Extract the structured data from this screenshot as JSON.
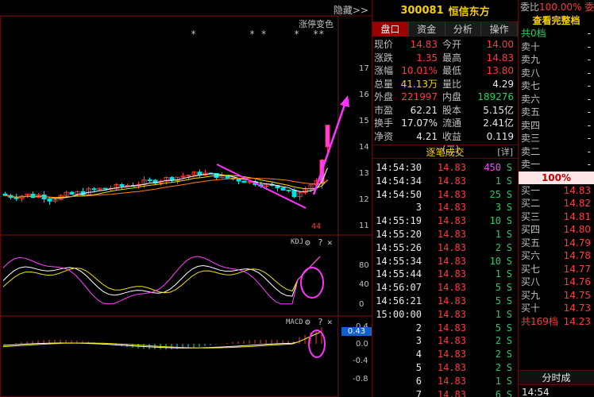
{
  "chart": {
    "hide_label": "隐藏>>",
    "limit_label": "涨停变色",
    "stars": [
      "*",
      "* *",
      "*",
      "**"
    ],
    "price_axis": [
      "17",
      "16",
      "15",
      "14",
      "13",
      "12",
      "11"
    ],
    "kdj": {
      "label": "KDJ",
      "axis": [
        "80",
        "40",
        "0"
      ]
    },
    "macd": {
      "label": "MACD",
      "axis": [
        "0.4",
        "0.0",
        "-0.4",
        "-0.8"
      ],
      "current": "0.43"
    },
    "low_marker": "44",
    "colors": {
      "up": "#ff3333",
      "down": "#00e0e0",
      "ma1": "#ffffff",
      "ma2": "#f0e000",
      "ma3": "#ff40ff",
      "annotation": "#ff33ff"
    }
  },
  "stock": {
    "code": "300081",
    "name": "恒信东方"
  },
  "tabs": [
    "盘口",
    "资金",
    "分析",
    "操作"
  ],
  "quote": [
    {
      "l": "现价",
      "v": "14.83",
      "vc": "red",
      "l2": "今开",
      "v2": "14.00",
      "v2c": "red"
    },
    {
      "l": "涨跌",
      "v": "1.35",
      "vc": "red",
      "l2": "最高",
      "v2": "14.83",
      "v2c": "red"
    },
    {
      "l": "涨幅",
      "v": "10.01%",
      "vc": "red",
      "l2": "最低",
      "v2": "13.80",
      "v2c": "red"
    },
    {
      "l": "总量",
      "v": "41.13万",
      "vc": "yellow",
      "l2": "量比",
      "v2": "4.29",
      "v2c": "white"
    },
    {
      "l": "外盘",
      "v": "221997",
      "vc": "red",
      "l2": "内盘",
      "v2": "189276",
      "v2c": "green"
    },
    {
      "l": "市盈",
      "v": "62.21",
      "vc": "white",
      "l2": "股本",
      "v2": "5.15亿",
      "v2c": "white"
    },
    {
      "l": "换手",
      "v": "17.07%",
      "vc": "white",
      "l2": "流通",
      "v2": "2.41亿",
      "v2c": "white"
    },
    {
      "l": "净资",
      "v": "4.21",
      "vc": "white",
      "l2": "收益(二)",
      "v2": "0.119",
      "v2c": "white"
    }
  ],
  "trades_header": {
    "title": "逐笔成交",
    "detail": "[详]"
  },
  "trades": [
    {
      "t": "14:54:30",
      "p": "14.83",
      "v": "450",
      "vc": "magenta",
      "s": "S"
    },
    {
      "t": "14:54:34",
      "p": "14.83",
      "v": "1",
      "vc": "green",
      "s": "S"
    },
    {
      "t": "14:54:50",
      "p": "14.83",
      "v": "25",
      "vc": "green",
      "s": "S"
    },
    {
      "t": "3",
      "p": "14.83",
      "v": "3",
      "vc": "green",
      "s": "S"
    },
    {
      "t": "14:55:19",
      "p": "14.83",
      "v": "10",
      "vc": "green",
      "s": "S"
    },
    {
      "t": "14:55:20",
      "p": "14.83",
      "v": "1",
      "vc": "green",
      "s": "S"
    },
    {
      "t": "14:55:26",
      "p": "14.83",
      "v": "2",
      "vc": "green",
      "s": "S"
    },
    {
      "t": "14:55:34",
      "p": "14.83",
      "v": "10",
      "vc": "green",
      "s": "S"
    },
    {
      "t": "14:55:44",
      "p": "14.83",
      "v": "1",
      "vc": "green",
      "s": "S"
    },
    {
      "t": "14:56:07",
      "p": "14.83",
      "v": "5",
      "vc": "green",
      "s": "S"
    },
    {
      "t": "14:56:21",
      "p": "14.83",
      "v": "5",
      "vc": "green",
      "s": "S"
    },
    {
      "t": "15:00:00",
      "p": "14.83",
      "v": "1",
      "vc": "green",
      "s": "S"
    },
    {
      "t": "2",
      "p": "14.83",
      "v": "5",
      "vc": "green",
      "s": "S"
    },
    {
      "t": "3",
      "p": "14.83",
      "v": "2",
      "vc": "green",
      "s": "S"
    },
    {
      "t": "4",
      "p": "14.83",
      "v": "2",
      "vc": "green",
      "s": "S"
    },
    {
      "t": "5",
      "p": "14.83",
      "v": "2",
      "vc": "green",
      "s": "S"
    },
    {
      "t": "6",
      "p": "14.83",
      "v": "1",
      "vc": "green",
      "s": "S"
    },
    {
      "t": "7",
      "p": "14.83",
      "v": "6",
      "vc": "green",
      "s": "S"
    }
  ],
  "orderbook": {
    "ratio_label": "委比",
    "ratio_value": "100.00% 委",
    "full_button": "查看完整档",
    "sell_total": "共0档",
    "sells": [
      "卖十",
      "卖九",
      "卖八",
      "卖七",
      "卖六",
      "卖五",
      "卖四",
      "卖三",
      "卖二",
      "卖一"
    ],
    "sell_values": [
      "-",
      "-",
      "-",
      "-",
      "-",
      "-",
      "-",
      "-",
      "-",
      "-"
    ],
    "buy_pct": "100%",
    "buys": [
      {
        "n": "买一",
        "p": "14.83"
      },
      {
        "n": "买二",
        "p": "14.82"
      },
      {
        "n": "买三",
        "p": "14.81"
      },
      {
        "n": "买四",
        "p": "14.80"
      },
      {
        "n": "买五",
        "p": "14.79"
      },
      {
        "n": "买六",
        "p": "14.78"
      },
      {
        "n": "买七",
        "p": "14.77"
      },
      {
        "n": "买八",
        "p": "14.76"
      },
      {
        "n": "买九",
        "p": "14.75"
      },
      {
        "n": "买十",
        "p": "14.73"
      }
    ],
    "buy_total": "共169档",
    "buy_total_price": "14.23",
    "time_tab": "分时成",
    "last_time": "14:54"
  }
}
